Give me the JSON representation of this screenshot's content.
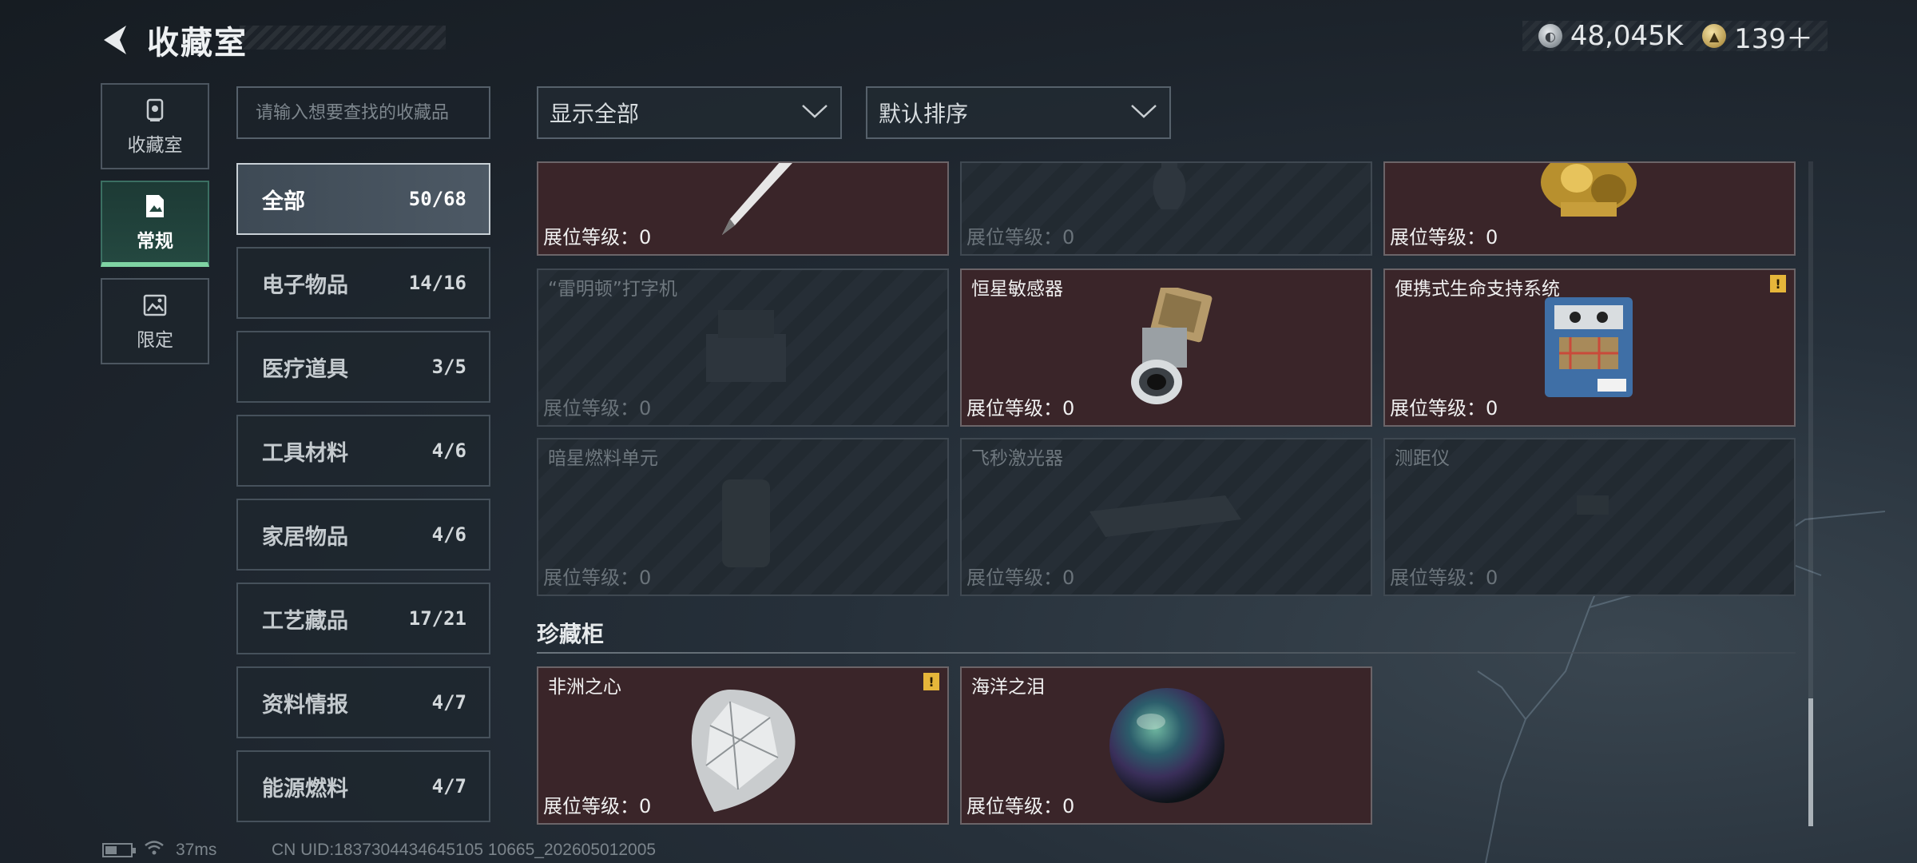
{
  "header": {
    "title": "收藏室"
  },
  "currency": [
    {
      "icon": "silver-coin-icon",
      "value": "48,045K"
    },
    {
      "icon": "gold-coin-icon",
      "value": "139＋"
    }
  ],
  "rail": [
    {
      "label": "收藏室",
      "icon": "trophy-icon",
      "active": false
    },
    {
      "label": "常规",
      "icon": "document-icon",
      "active": true
    },
    {
      "label": "限定",
      "icon": "photo-icon",
      "active": false
    }
  ],
  "search": {
    "placeholder": "请输入想要查找的收藏品",
    "value": ""
  },
  "categories": [
    {
      "name": "全部",
      "count": "50/68",
      "active": true
    },
    {
      "name": "电子物品",
      "count": "14/16"
    },
    {
      "name": "医疗道具",
      "count": "3/5"
    },
    {
      "name": "工具材料",
      "count": "4/6"
    },
    {
      "name": "家居物品",
      "count": "4/6"
    },
    {
      "name": "工艺藏品",
      "count": "17/21"
    },
    {
      "name": "资料情报",
      "count": "4/7"
    },
    {
      "name": "能源燃料",
      "count": "4/7"
    }
  ],
  "filters": {
    "show": "显示全部",
    "sort": "默认排序"
  },
  "level_prefix": "展位等级：",
  "items": [
    {
      "name": "",
      "level": "0",
      "owned": true,
      "art": "pen-icon"
    },
    {
      "name": "",
      "level": "0",
      "owned": false,
      "art": "vase-icon"
    },
    {
      "name": "",
      "level": "0",
      "owned": true,
      "art": "golden-statue-icon"
    },
    {
      "name": "“雷明顿”打字机",
      "level": "0",
      "owned": false,
      "art": "typewriter-icon"
    },
    {
      "name": "恒星敏感器",
      "level": "0",
      "owned": true,
      "art": "star-sensor-icon"
    },
    {
      "name": "便携式生命支持系统",
      "level": "0",
      "owned": true,
      "warn": true,
      "art": "life-support-icon"
    },
    {
      "name": "暗星燃料单元",
      "level": "0",
      "owned": false,
      "art": "fuel-cell-icon"
    },
    {
      "name": "飞秒激光器",
      "level": "0",
      "owned": false,
      "art": "laser-icon"
    },
    {
      "name": "测距仪",
      "level": "0",
      "owned": false,
      "art": "rangefinder-icon"
    }
  ],
  "section": {
    "title": "珍藏柜"
  },
  "treasures": [
    {
      "name": "非洲之心",
      "level": "0",
      "owned": true,
      "warn": true,
      "art": "diamond-icon"
    },
    {
      "name": "海洋之泪",
      "level": "0",
      "owned": true,
      "art": "pearl-icon"
    }
  ],
  "footer": {
    "ping": "37ms",
    "uid": "CN UID:1837304434645105 10665_202605012005",
    "battery_level": 0.45
  },
  "colors": {
    "owned_card": "#3a2529",
    "accent_green": "#7fd3a3",
    "warn_yellow": "#e6b63a"
  }
}
